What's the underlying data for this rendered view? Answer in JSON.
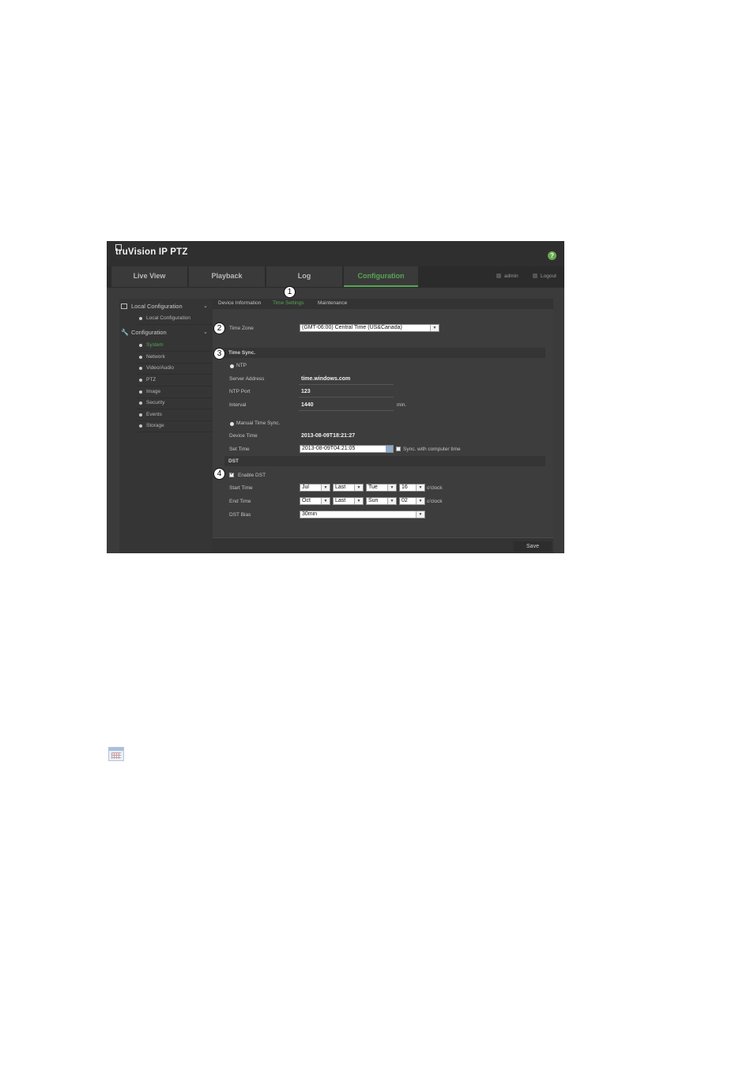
{
  "app": {
    "brand": "truVision IP PTZ",
    "help_glyph": "?"
  },
  "nav": {
    "tabs": [
      {
        "label": "Live View"
      },
      {
        "label": "Playback"
      },
      {
        "label": "Log"
      },
      {
        "label": "Configuration",
        "active": true
      }
    ],
    "user": "admin",
    "logout": "Logout"
  },
  "sidebar": {
    "local_header": "Local Configuration",
    "local_items": [
      "Local Configuration"
    ],
    "config_header": "Configuration",
    "config_items": [
      "System",
      "Network",
      "Video/Audio",
      "PTZ",
      "Image",
      "Security",
      "Events",
      "Storage"
    ],
    "active_item": "System"
  },
  "subtabs": [
    "Device Information",
    "Time Settings",
    "Maintenance"
  ],
  "active_subtab": "Time Settings",
  "callouts": [
    "1",
    "2",
    "3",
    "4"
  ],
  "time_zone": {
    "label": "Time Zone",
    "value": "(GMT-06:00) Central Time (US&Canada)"
  },
  "time_sync": {
    "header": "Time Sync.",
    "ntp_label": "NTP",
    "server_address_label": "Server Address",
    "server_address": "time.windows.com",
    "ntp_port_label": "NTP Port",
    "ntp_port": "123",
    "interval_label": "Interval",
    "interval": "1440",
    "interval_unit": "min.",
    "manual_label": "Manual Time Sync.",
    "device_time_label": "Device Time",
    "device_time": "2013-08-09T18:21:27",
    "set_time_label": "Set Time",
    "set_time": "2013-08-09T04:21:05",
    "sync_computer_label": "Sync. with computer time"
  },
  "dst": {
    "header": "DST",
    "enable_label": "Enable DST",
    "enabled": true,
    "start_label": "Start Time",
    "start": {
      "month": "Jul",
      "week": "Last",
      "day": "Tue",
      "hour": "16"
    },
    "end_label": "End Time",
    "end": {
      "month": "Oct",
      "week": "Last",
      "day": "Sun",
      "hour": "02"
    },
    "oclock": "o'clock",
    "bias_label": "DST Bias",
    "bias": "30min"
  },
  "save_label": "Save",
  "colors": {
    "accent": "#56a556",
    "panel": "#3b3b3b",
    "header": "#2f2f2f"
  }
}
